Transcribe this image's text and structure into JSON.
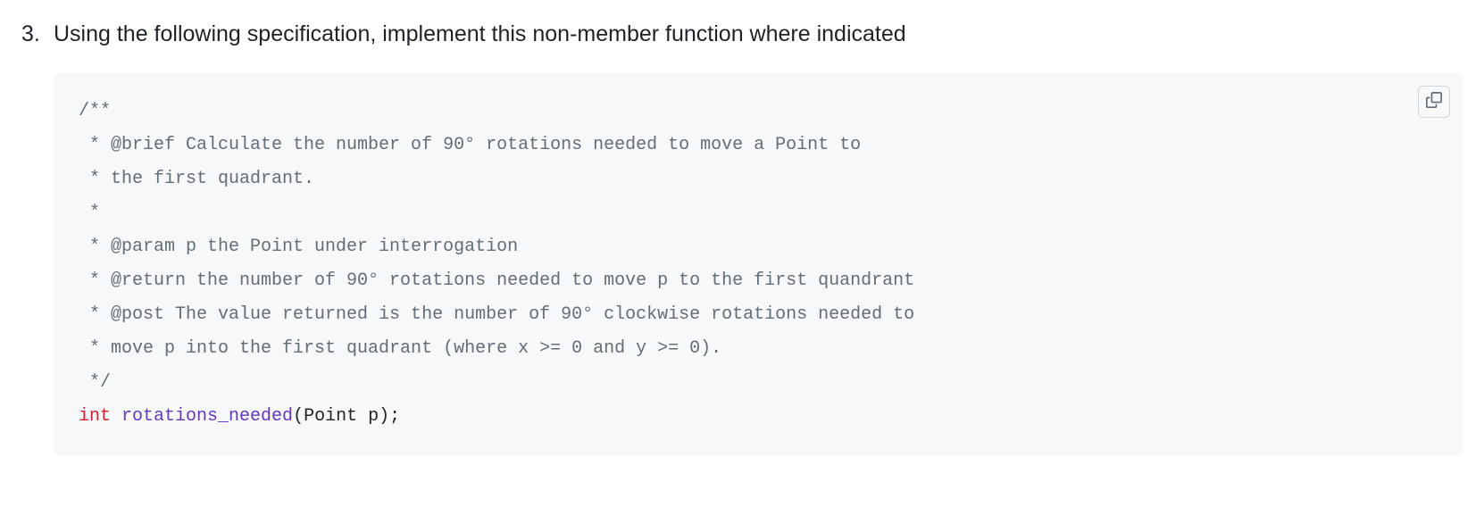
{
  "question": {
    "number": "3.",
    "text": "Using the following specification, implement this non-member function where indicated"
  },
  "code": {
    "line1": "/**",
    "line2": " * @brief Calculate the number of 90° rotations needed to move a Point to",
    "line3": " * the first quadrant.",
    "line4": " *",
    "line5": " * @param p the Point under interrogation",
    "line6": " * @return the number of 90° rotations needed to move p to the first quandrant",
    "line7": " * @post The value returned is the number of 90° clockwise rotations needed to",
    "line8": " * move p into the first quadrant (where x >= 0 and y >= 0).",
    "line9": " */",
    "sig_keyword": "int",
    "sig_space1": " ",
    "sig_function": "rotations_needed",
    "sig_rest": "(Point p);"
  }
}
